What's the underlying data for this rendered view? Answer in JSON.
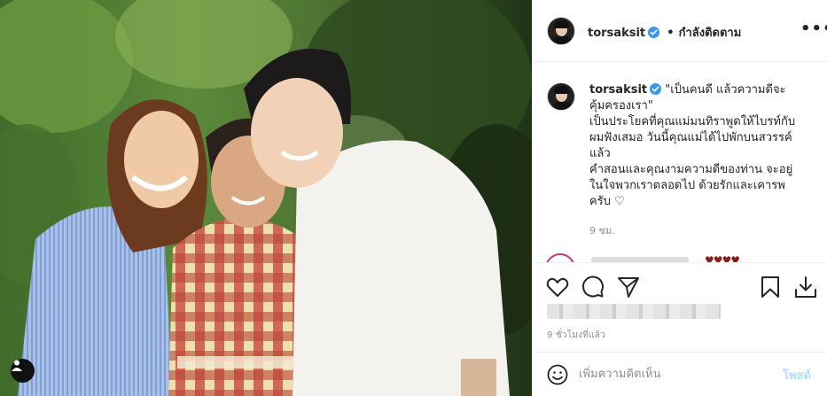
{
  "post": {
    "photo_alt": "",
    "username": "torsaksit",
    "follow_separator": "•",
    "follow_status": "กำลังติดตาม",
    "more_label": "•••"
  },
  "caption": {
    "username": "torsaksit",
    "text": "\"เป็นคนดี แล้วความดีจะ\nคุ้มครองเรา\"\nเป็นประโยคที่คุณแม่มนทิราพูดให้ไบรท์กับ\nผมฟังเสมอ วันนี้คุณแม่ได้ไปพักบนสวรรค์\nแล้ว\nคำสอนและคุณงามความดีของท่าน จะอยู่\nในใจพวกเราตลอดไป ด้วยรักและเคารพ\nครับ ♡",
    "time_small": "9 ชม."
  },
  "comments_peek": {
    "hearts": "♥♥♥♥"
  },
  "actions": {
    "like_icon": "heart-icon",
    "comment_icon": "comment-icon",
    "share_icon": "paper-plane-icon",
    "save_icon": "bookmark-icon",
    "download_icon": "download-icon"
  },
  "meta": {
    "time_ago": "9 ชั่วโมงที่แล้ว"
  },
  "comment_box": {
    "placeholder": "เพิ่มความคิดเห็น",
    "post_label": "โพสต์",
    "post_color_disabled": "#b2dffc"
  },
  "colors": {
    "verified": "#3897f0",
    "text": "#262626",
    "muted": "#8e8e8e",
    "border": "#efefef"
  }
}
